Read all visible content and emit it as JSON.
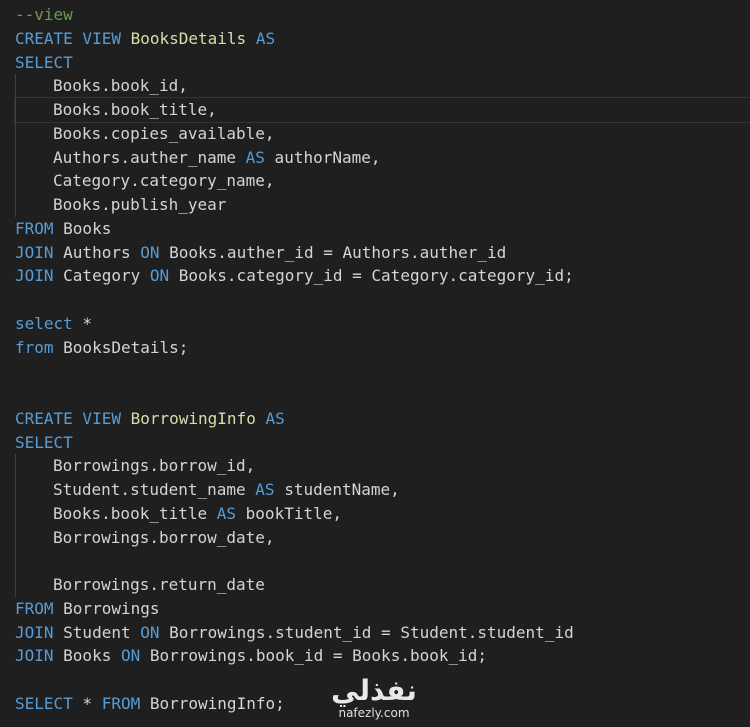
{
  "editor": {
    "highlighted_line": 4,
    "lines": [
      [
        {
          "t": "--view",
          "c": "cm"
        }
      ],
      [
        {
          "t": "CREATE VIEW ",
          "c": "kw"
        },
        {
          "t": "BooksDetails",
          "c": "fn"
        },
        {
          "t": " AS",
          "c": "kw"
        }
      ],
      [
        {
          "t": "SELECT",
          "c": "kw"
        }
      ],
      [
        {
          "t": "Books.book_id,",
          "c": "tx",
          "indent": true
        }
      ],
      [
        {
          "t": "Books.book_title,",
          "c": "tx",
          "indent": true
        }
      ],
      [
        {
          "t": "Books.copies_available,",
          "c": "tx",
          "indent": true
        }
      ],
      [
        {
          "t": "Authors.auther_name ",
          "c": "tx",
          "indent": true
        },
        {
          "t": "AS",
          "c": "kw"
        },
        {
          "t": " authorName,",
          "c": "tx"
        }
      ],
      [
        {
          "t": "Category.category_name,",
          "c": "tx",
          "indent": true
        }
      ],
      [
        {
          "t": "Books.publish_year",
          "c": "tx",
          "indent": true
        }
      ],
      [
        {
          "t": "FROM",
          "c": "kw"
        },
        {
          "t": " Books",
          "c": "tx"
        }
      ],
      [
        {
          "t": "JOIN",
          "c": "kw"
        },
        {
          "t": " Authors ",
          "c": "tx"
        },
        {
          "t": "ON",
          "c": "kw"
        },
        {
          "t": " Books.auther_id = Authors.auther_id",
          "c": "tx"
        }
      ],
      [
        {
          "t": "JOIN",
          "c": "kw"
        },
        {
          "t": " Category ",
          "c": "tx"
        },
        {
          "t": "ON",
          "c": "kw"
        },
        {
          "t": " Books.category_id = Category.category_id;",
          "c": "tx"
        }
      ],
      [],
      [
        {
          "t": "select",
          "c": "kw"
        },
        {
          "t": " *",
          "c": "tx"
        }
      ],
      [
        {
          "t": "from",
          "c": "kw"
        },
        {
          "t": " BooksDetails;",
          "c": "tx"
        }
      ],
      [],
      [],
      [
        {
          "t": "CREATE VIEW ",
          "c": "kw"
        },
        {
          "t": "BorrowingInfo",
          "c": "fn"
        },
        {
          "t": " AS",
          "c": "kw"
        }
      ],
      [
        {
          "t": "SELECT",
          "c": "kw"
        }
      ],
      [
        {
          "t": "Borrowings.borrow_id,",
          "c": "tx",
          "indent": true
        }
      ],
      [
        {
          "t": "Student.student_name ",
          "c": "tx",
          "indent": true
        },
        {
          "t": "AS",
          "c": "kw"
        },
        {
          "t": " studentName,",
          "c": "tx"
        }
      ],
      [
        {
          "t": "Books.book_title ",
          "c": "tx",
          "indent": true
        },
        {
          "t": "AS",
          "c": "kw"
        },
        {
          "t": " bookTitle,",
          "c": "tx"
        }
      ],
      [
        {
          "t": "Borrowings.borrow_date,",
          "c": "tx",
          "indent": true
        }
      ],
      [
        {
          "t": "",
          "c": "tx",
          "indent": true
        }
      ],
      [
        {
          "t": "Borrowings.return_date",
          "c": "tx",
          "indent": true
        }
      ],
      [
        {
          "t": "FROM",
          "c": "kw"
        },
        {
          "t": " Borrowings",
          "c": "tx"
        }
      ],
      [
        {
          "t": "JOIN",
          "c": "kw"
        },
        {
          "t": " Student ",
          "c": "tx"
        },
        {
          "t": "ON",
          "c": "kw"
        },
        {
          "t": " Borrowings.student_id = Student.student_id",
          "c": "tx"
        }
      ],
      [
        {
          "t": "JOIN",
          "c": "kw"
        },
        {
          "t": " Books ",
          "c": "tx"
        },
        {
          "t": "ON",
          "c": "kw"
        },
        {
          "t": " Borrowings.book_id = Books.book_id;",
          "c": "tx"
        }
      ],
      [],
      [
        {
          "t": "SELECT",
          "c": "kw"
        },
        {
          "t": " * ",
          "c": "tx"
        },
        {
          "t": "FROM",
          "c": "kw"
        },
        {
          "t": " BorrowingInfo;",
          "c": "tx"
        }
      ]
    ]
  },
  "watermark": {
    "arabic": "نفذلي",
    "latin": "nafezly.com"
  },
  "colors": {
    "background": "#1f1f1f",
    "keyword": "#569cd6",
    "comment": "#6a9955",
    "identifier": "#dcdcaa",
    "text": "#d4d4d4"
  }
}
